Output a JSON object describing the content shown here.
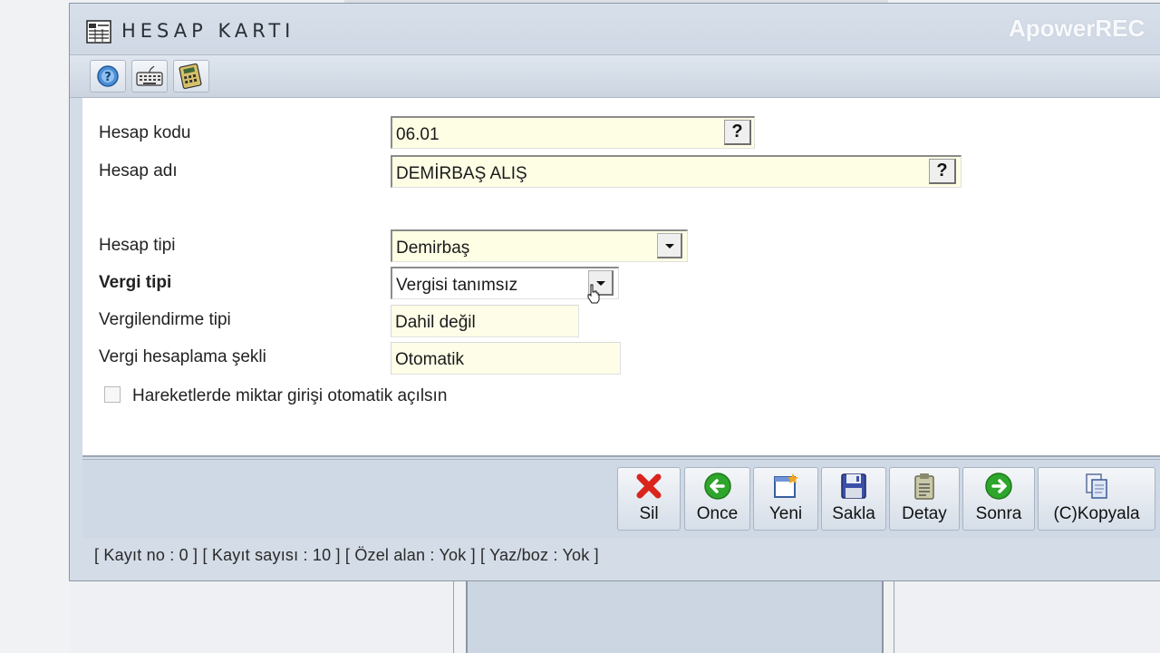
{
  "window": {
    "title": "HESAP KARTI",
    "watermark": "ApowerREC"
  },
  "toolbar": {
    "icons": [
      "help-icon",
      "keyboard-icon",
      "calculator-icon"
    ]
  },
  "form": {
    "hesap_kodu": {
      "label": "Hesap kodu",
      "value": "06.01",
      "button": "?"
    },
    "hesap_adi": {
      "label": "Hesap adı",
      "value": "DEMİRBAŞ ALIŞ",
      "button": "?"
    },
    "hesap_tipi": {
      "label": "Hesap tipi",
      "value": "Demirbaş"
    },
    "vergi_tipi": {
      "label": "Vergi tipi",
      "value": "Vergisi tanımsız"
    },
    "vergilendirme_tipi": {
      "label": "Vergilendirme tipi",
      "value": "Dahil değil"
    },
    "vergi_hesaplama": {
      "label": "Vergi hesaplama şekli",
      "value": "Otomatik"
    },
    "checkbox": {
      "label": "Hareketlerde miktar girişi otomatik açılsın",
      "checked": false
    }
  },
  "buttons": {
    "sil": "Sil",
    "once": "Once",
    "yeni": "Yeni",
    "sakla": "Sakla",
    "detay": "Detay",
    "sonra": "Sonra",
    "kopyala": "(C)Kopyala"
  },
  "status": {
    "text": "[ Kayıt no : 0 ] [ Kayıt sayısı : 10 ] [ Özel alan : Yok ] [ Yaz/boz : Yok ]"
  },
  "colors": {
    "field_bg": "#fefee5",
    "window_bg": "#d4dce7",
    "delete_red": "#d9251c",
    "nav_green": "#2ea52b"
  }
}
